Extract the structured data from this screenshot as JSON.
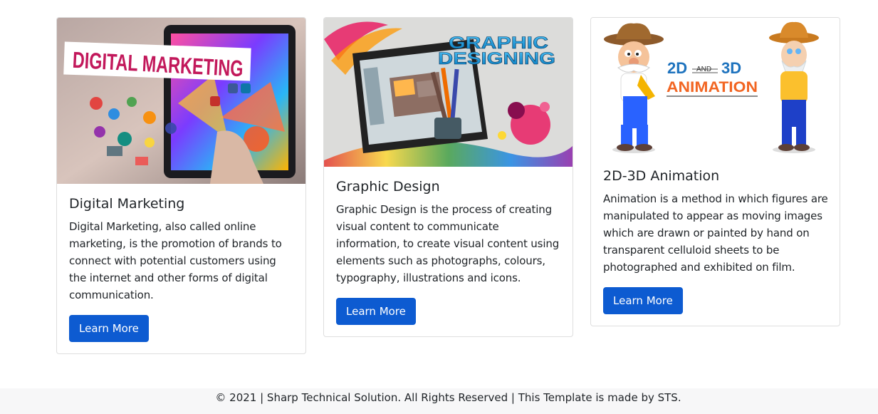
{
  "cards": [
    {
      "image_text": "DIGITAL MARKETING",
      "title": "Digital Marketing",
      "text": "Digital Marketing, also called online marketing, is the promotion of brands to connect with potential customers using the internet and other forms of digital communication.",
      "button_label": "Learn More"
    },
    {
      "image_text_1": "GRAPHIC",
      "image_text_2": "DESIGNING",
      "title": "Graphic Design",
      "text": "Graphic Design is the process of creating visual content to communicate information, to create visual content using elements such as photographs, colours, typography, illustrations and icons.",
      "button_label": "Learn More"
    },
    {
      "image_text_1": "2D",
      "image_text_and": "AND",
      "image_text_2": "3D",
      "image_text_3": "ANIMATION",
      "title": "2D-3D Animation",
      "text": "Animation is a method in which figures are manipulated to appear as moving images which are drawn or painted by hand on transparent celluloid sheets to be photographed and exhibited on film.",
      "button_label": "Learn More"
    }
  ],
  "footer": {
    "text": "© 2021 | Sharp Technical Solution. All Rights Reserved | This Template is made by STS."
  },
  "colors": {
    "button": "#0d5bd1",
    "footer_bg": "#f7f7f8",
    "marketing_text": "#c2185b",
    "animation_orange": "#f26522",
    "animation_blue": "#1e73be"
  }
}
